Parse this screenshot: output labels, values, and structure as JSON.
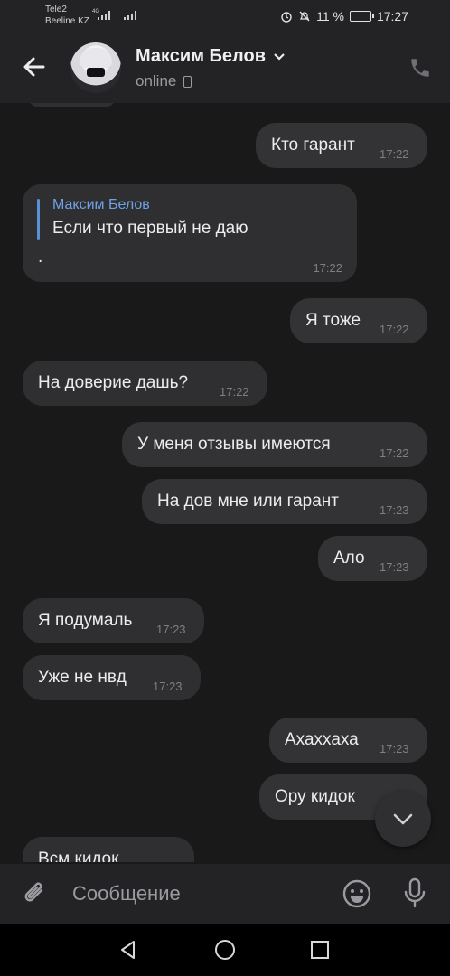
{
  "status_bar": {
    "carrier1": "Tele2",
    "carrier2": "Beeline KZ",
    "net": "4G",
    "battery": "11 %",
    "time": "17:27"
  },
  "header": {
    "contact_name": "Максим Белов",
    "status": "online"
  },
  "messages": [
    {
      "dir": "out",
      "text": "Кто гарант",
      "time": "17:22"
    },
    {
      "dir": "in",
      "reply_name": "Максим Белов",
      "reply_text": "Если что первый не даю",
      "text": ".",
      "time": "17:22"
    },
    {
      "dir": "out",
      "text": "Я тоже",
      "time": "17:22"
    },
    {
      "dir": "in",
      "text": "На доверие дашь?",
      "time": "17:22"
    },
    {
      "dir": "out",
      "text": "У меня отзывы имеются",
      "time": "17:22"
    },
    {
      "dir": "out",
      "text": "На дов мне или гарант",
      "time": "17:23"
    },
    {
      "dir": "out",
      "text": "Ало",
      "time": "17:23"
    },
    {
      "dir": "in",
      "text": "Я подумаль",
      "time": "17:23"
    },
    {
      "dir": "in",
      "text": "Уже не нвд",
      "time": "17:23"
    },
    {
      "dir": "out",
      "text": "Ахаххаха",
      "time": "17:23"
    },
    {
      "dir": "out",
      "text": "Ору кидок",
      "time": ""
    },
    {
      "dir": "in",
      "text": "Всм кидок",
      "time": ""
    }
  ],
  "composer": {
    "placeholder": "Сообщение"
  }
}
